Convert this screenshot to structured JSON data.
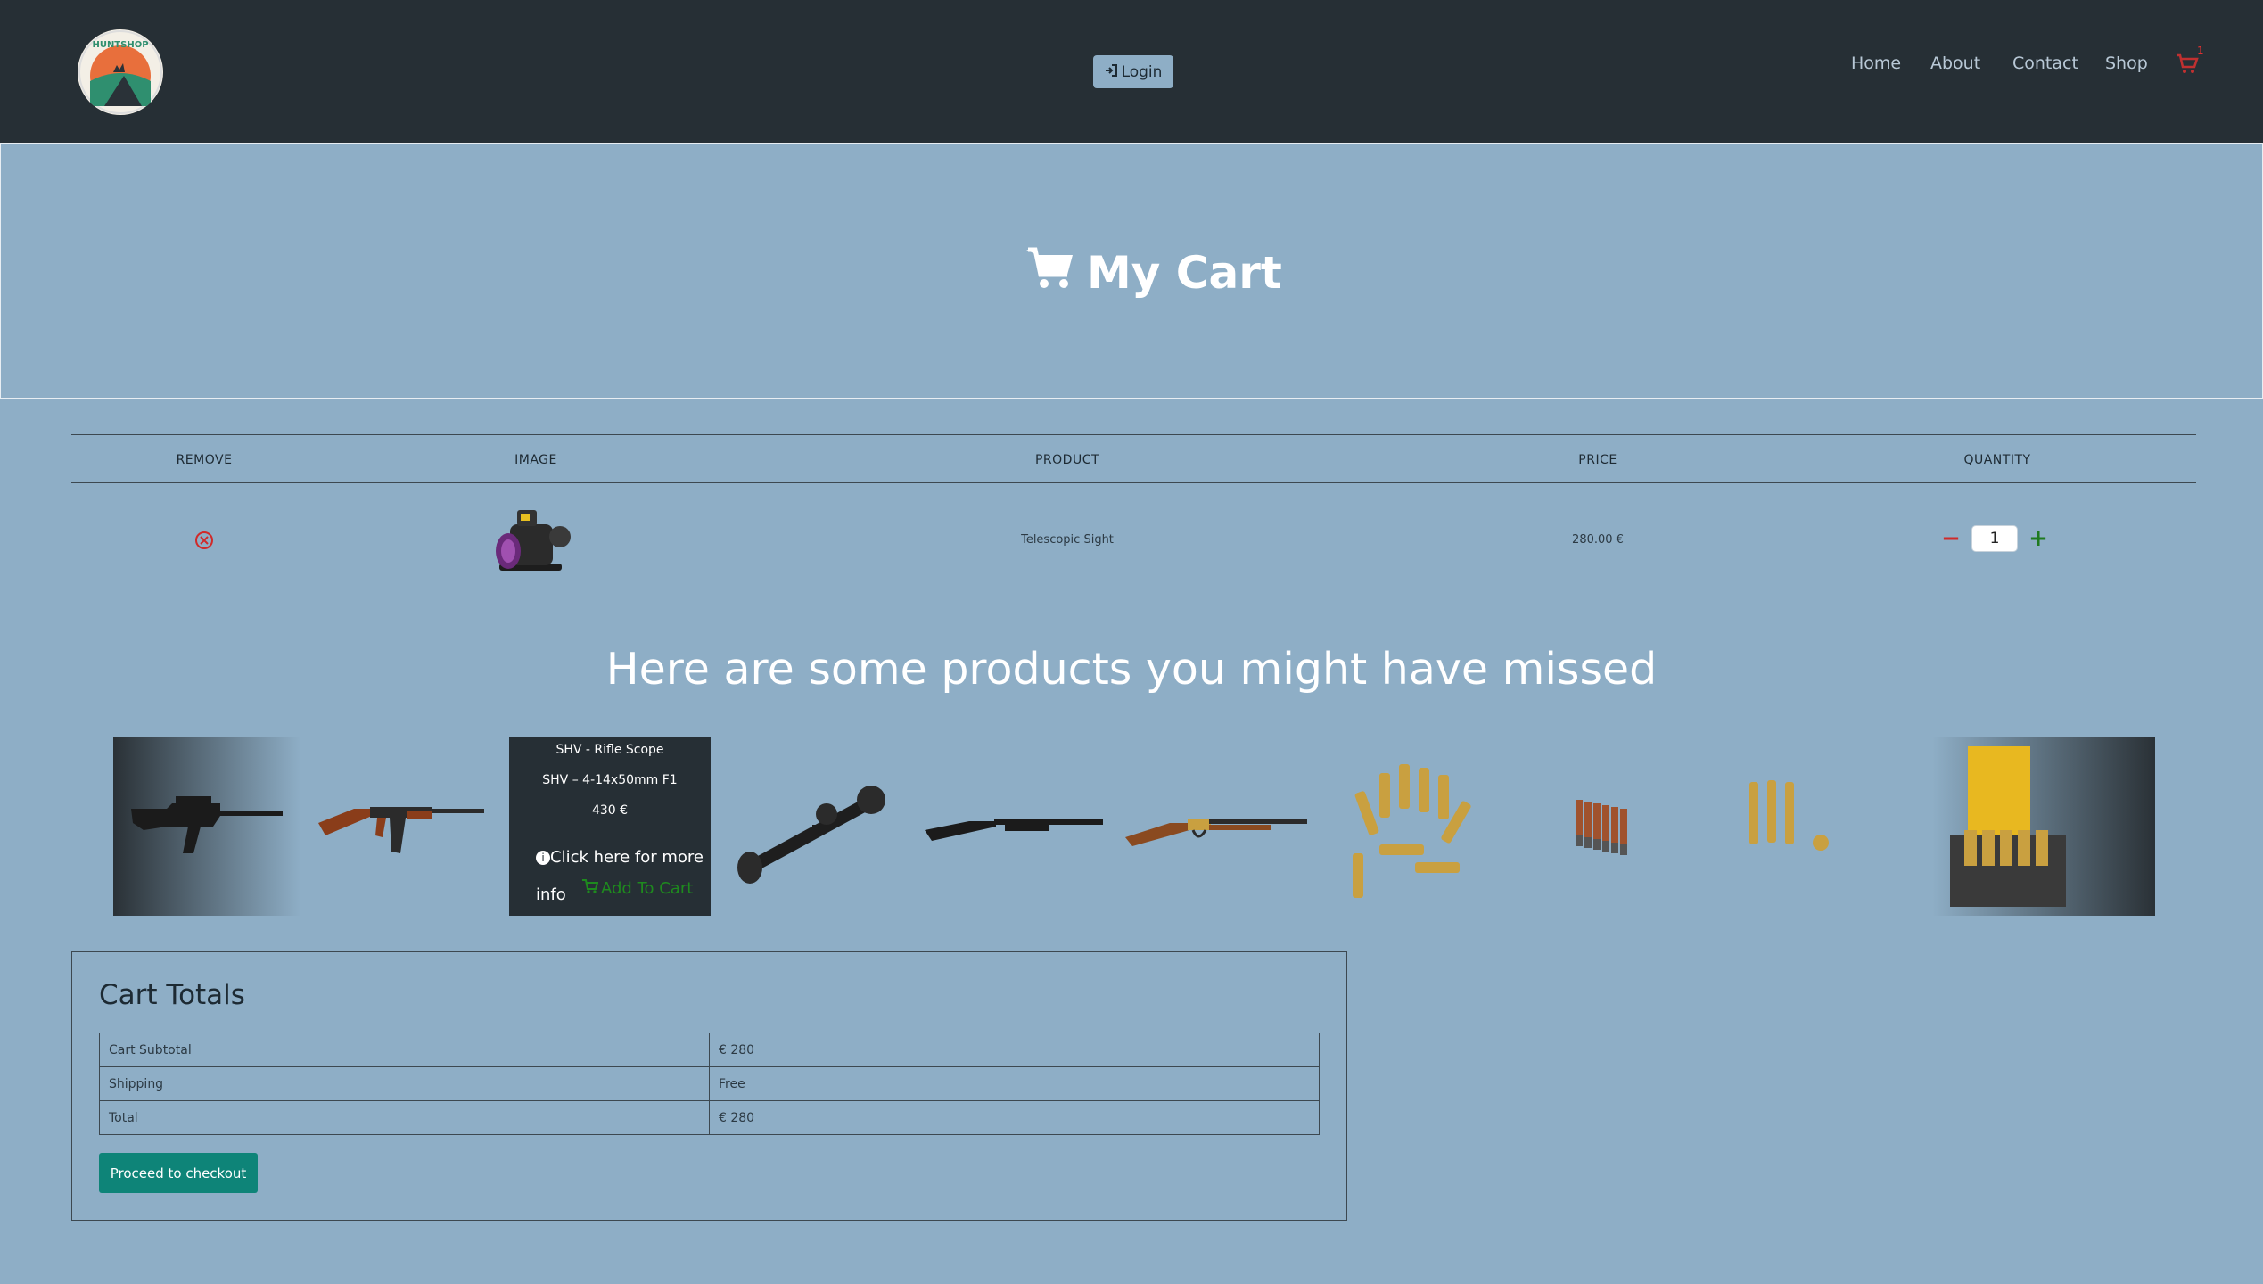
{
  "header": {
    "logo_text": "HUNTSHOP",
    "login_label": "Login",
    "nav": [
      "Home",
      "About",
      "Contact",
      "Shop"
    ],
    "cart_count": "1"
  },
  "hero": {
    "title": "My Cart"
  },
  "cart": {
    "columns": [
      "REMOVE",
      "IMAGE",
      "PRODUCT",
      "PRICE",
      "QUANTITY"
    ],
    "rows": [
      {
        "product": "Telescopic Sight",
        "price": "280.00 €",
        "quantity": "1"
      }
    ]
  },
  "suggestions": {
    "title": "Here are some products you might have missed",
    "overlay": {
      "name": "SHV - Rifle Scope",
      "subtitle": "SHV – 4-14x50mm F1",
      "price": "430 €",
      "info": "Click here for more info",
      "add_to_cart": "Add To Cart"
    }
  },
  "totals": {
    "title": "Cart Totals",
    "rows": [
      {
        "label": "Cart Subtotal",
        "value": "€ 280"
      },
      {
        "label": "Shipping",
        "value": "Free"
      },
      {
        "label": "Total",
        "value": "€ 280"
      }
    ],
    "checkout_label": "Proceed to checkout"
  },
  "colors": {
    "page_bg": "#8eaec6",
    "navbar_bg": "#262f35",
    "checkout_bg": "#0e8478",
    "remove_red": "#d02a2a",
    "add_green": "#1f7a1f"
  }
}
